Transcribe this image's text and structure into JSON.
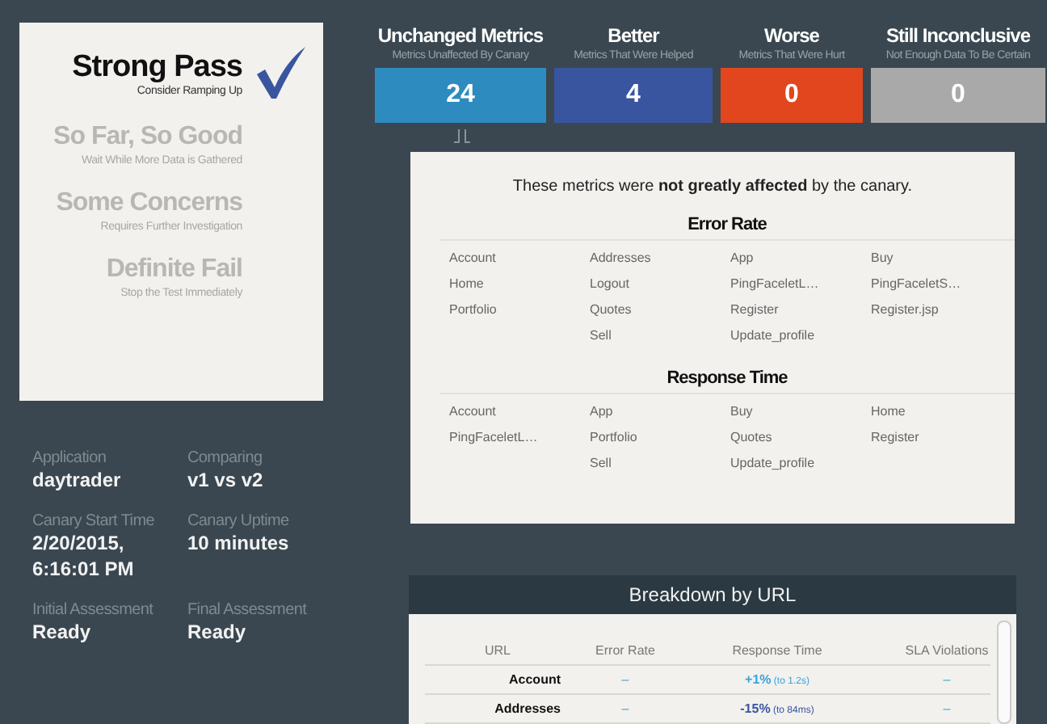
{
  "assessments": [
    {
      "title": "Strong Pass",
      "subtitle": "Consider Ramping Up",
      "selected": true
    },
    {
      "title": "So Far, So Good",
      "subtitle": "Wait While More Data is Gathered",
      "selected": false
    },
    {
      "title": "Some Concerns",
      "subtitle": "Requires Further Investigation",
      "selected": false
    },
    {
      "title": "Definite Fail",
      "subtitle": "Stop the Test Immediately",
      "selected": false
    }
  ],
  "info": [
    {
      "label": "Application",
      "value": "daytrader"
    },
    {
      "label": "Comparing",
      "value": "v1 vs v2"
    },
    {
      "label": "Canary Start Time",
      "value": "2/20/2015, 6:16:01 PM"
    },
    {
      "label": "Canary Uptime",
      "value": "10 minutes"
    },
    {
      "label": "Initial Assessment",
      "value": "Ready"
    },
    {
      "label": "Final Assessment",
      "value": "Ready"
    }
  ],
  "metric_tiles": [
    {
      "title": "Unchanged Metrics",
      "subtitle": "Metrics Unaffected By Canary",
      "count": "24",
      "color": "#2e8bbf"
    },
    {
      "title": "Better",
      "subtitle": "Metrics That Were Helped",
      "count": "4",
      "color": "#3a559f"
    },
    {
      "title": "Worse",
      "subtitle": "Metrics That Were Hurt",
      "count": "0",
      "color": "#e1461f"
    },
    {
      "title": "Still Inconclusive",
      "subtitle": "Not Enough Data To Be Certain",
      "count": "0",
      "color": "#a9a9a9"
    }
  ],
  "details": {
    "summary": "These metrics were **not greatly affected** by the canary.",
    "groups": [
      {
        "heading": "Error Rate",
        "columns": [
          [
            "Account",
            "Home",
            "Portfolio"
          ],
          [
            "Addresses",
            "Logout",
            "Quotes",
            "Sell"
          ],
          [
            "App",
            "PingFaceletL…",
            "Register",
            "Update_profile"
          ],
          [
            "Buy",
            "PingFaceletS…",
            "Register.jsp"
          ]
        ]
      },
      {
        "heading": "Response Time",
        "columns": [
          [
            "Account",
            "PingFaceletL…"
          ],
          [
            "App",
            "Portfolio",
            "Sell"
          ],
          [
            "Buy",
            "Quotes",
            "Update_profile"
          ],
          [
            "Home",
            "Register"
          ]
        ]
      }
    ]
  },
  "breakdown": {
    "title": "Breakdown by URL",
    "columns": [
      "URL",
      "Error Rate",
      "Response Time",
      "SLA Violations"
    ],
    "rows": [
      {
        "url": "Account",
        "error_rate": "–",
        "change": "+1%",
        "detail": "(to 1.2s)",
        "color": "#3aa3dc",
        "sla": "–"
      },
      {
        "url": "Addresses",
        "error_rate": "–",
        "change": "-15%",
        "detail": "(to 84ms)",
        "color": "#3a559f",
        "sla": "–"
      }
    ]
  }
}
